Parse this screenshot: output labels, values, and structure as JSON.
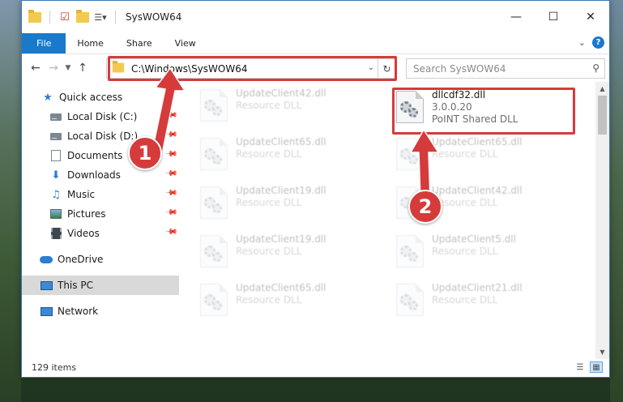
{
  "window": {
    "title": "SysWOW64"
  },
  "ribbon": {
    "tabs": [
      "File",
      "Home",
      "Share",
      "View"
    ]
  },
  "address": {
    "path": "C:\\Windows\\SysWOW64",
    "search_placeholder": "Search SysWOW64"
  },
  "nav": {
    "items": [
      {
        "label": "Quick access",
        "icon": "star-icon",
        "pinned": false
      },
      {
        "label": "Local Disk (C:)",
        "icon": "disk-icon",
        "pinned": true
      },
      {
        "label": "Local Disk (D:)",
        "icon": "disk-icon",
        "pinned": true
      },
      {
        "label": "Documents",
        "icon": "documents-icon",
        "pinned": true
      },
      {
        "label": "Downloads",
        "icon": "downloads-icon",
        "pinned": true
      },
      {
        "label": "Music",
        "icon": "music-icon",
        "pinned": true
      },
      {
        "label": "Pictures",
        "icon": "pictures-icon",
        "pinned": true
      },
      {
        "label": "Videos",
        "icon": "videos-icon",
        "pinned": true
      },
      {
        "label": "OneDrive",
        "icon": "onedrive-icon",
        "pinned": false
      },
      {
        "label": "This PC",
        "icon": "this-pc-icon",
        "pinned": false,
        "selected": true
      },
      {
        "label": "Network",
        "icon": "network-icon",
        "pinned": false
      }
    ]
  },
  "files": {
    "highlighted": {
      "name": "dllcdf32.dll",
      "version": "3.0.0.20",
      "description": "PoINT Shared DLL"
    },
    "left_column": [
      {
        "name": "UpdateClient42.dll",
        "type": "Resource DLL"
      },
      {
        "name": "UpdateClient65.dll",
        "type": "Resource DLL"
      },
      {
        "name": "UpdateClient19.dll",
        "type": "Resource DLL"
      },
      {
        "name": "UpdateClient19.dll",
        "type": "Resource DLL"
      },
      {
        "name": "UpdateClient65.dll",
        "type": "Resource DLL"
      }
    ],
    "right_column": [
      {
        "name": "UpdateClient65.dll",
        "type": "Resource DLL"
      },
      {
        "name": "UpdateClient42.dll",
        "type": "Resource DLL"
      },
      {
        "name": "UpdateClient5.dll",
        "type": "Resource DLL"
      },
      {
        "name": "UpdateClient21.dll",
        "type": "Resource DLL"
      }
    ]
  },
  "status": {
    "item_count": "129 items"
  },
  "annotations": {
    "step1": "1",
    "step2": "2"
  },
  "colors": {
    "accent": "#1979ca",
    "highlight_red": "#d63b3b",
    "selection": "#d9d9d9"
  }
}
